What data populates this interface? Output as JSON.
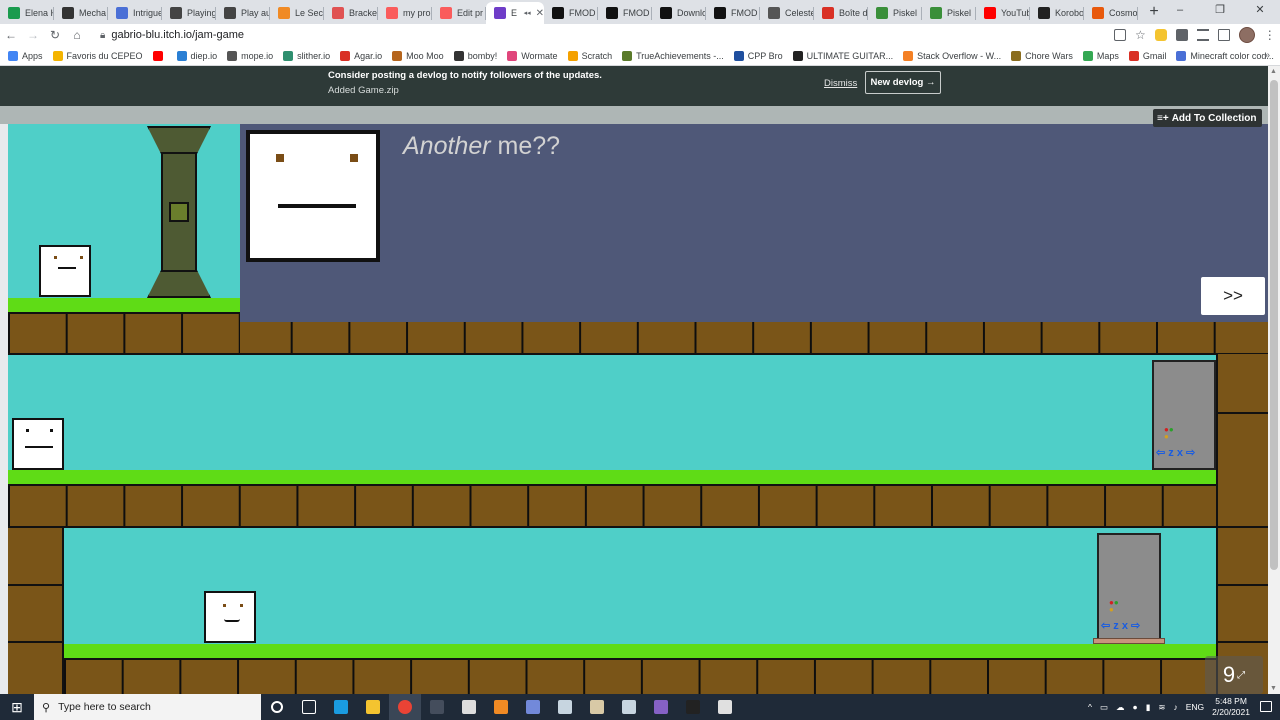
{
  "browser": {
    "tabs": [
      {
        "title": "Elena H",
        "color": "#1a9b4e"
      },
      {
        "title": "Mecha",
        "color": "#333333"
      },
      {
        "title": "Intrigue",
        "color": "#4a6fd6"
      },
      {
        "title": "Playing",
        "color": "#444444"
      },
      {
        "title": "Play au",
        "color": "#444444"
      },
      {
        "title": "Le Secr",
        "color": "#f08a24"
      },
      {
        "title": "Bracke",
        "color": "#e05252"
      },
      {
        "title": "my pro",
        "color": "#fa5c5c"
      },
      {
        "title": "Edit pr",
        "color": "#fa5c5c"
      },
      {
        "title": "E",
        "color": "#6f3dc8",
        "active": true
      },
      {
        "title": "FMOD",
        "color": "#111111"
      },
      {
        "title": "FMOD",
        "color": "#111111"
      },
      {
        "title": "Downlo",
        "color": "#111111"
      },
      {
        "title": "FMOD",
        "color": "#111111"
      },
      {
        "title": "Celeste",
        "color": "#555555"
      },
      {
        "title": "Boîte d",
        "color": "#d93025"
      },
      {
        "title": "Piskel",
        "color": "#3a8f3a"
      },
      {
        "title": "Piskel",
        "color": "#3a8f3a"
      },
      {
        "title": "YouTub",
        "color": "#ff0000"
      },
      {
        "title": "Korobo",
        "color": "#222222"
      },
      {
        "title": "Cosmo",
        "color": "#e8590c"
      }
    ],
    "new_tab": "+",
    "window_controls": [
      "–",
      "❐",
      "✕"
    ],
    "url": "gabrio-blu.itch.io/jam-game",
    "bookmarks": [
      {
        "label": "Apps",
        "color": "#4285f4"
      },
      {
        "label": "Favoris du CEPEO",
        "color": "#f4b400"
      },
      {
        "label": "",
        "color": "#ff0000"
      },
      {
        "label": "diep.io",
        "color": "#2a7fd4"
      },
      {
        "label": "mope.io",
        "color": "#555555"
      },
      {
        "label": "slither.io",
        "color": "#2f8f6f"
      },
      {
        "label": "Agar.io",
        "color": "#d93025"
      },
      {
        "label": "Moo Moo",
        "color": "#b5651d"
      },
      {
        "label": "bomby!",
        "color": "#333333"
      },
      {
        "label": "Wormate",
        "color": "#e0457b"
      },
      {
        "label": "Scratch",
        "color": "#f4a100"
      },
      {
        "label": "TrueAchievements -...",
        "color": "#5a7a2a"
      },
      {
        "label": "CPP Bro",
        "color": "#1f4f9f"
      },
      {
        "label": "ULTIMATE GUITAR...",
        "color": "#222222"
      },
      {
        "label": "Stack Overflow - W...",
        "color": "#f48024"
      },
      {
        "label": "Chore Wars",
        "color": "#8a6d1f"
      },
      {
        "label": "Maps",
        "color": "#34a853"
      },
      {
        "label": "Gmail",
        "color": "#d93025"
      },
      {
        "label": "Minecraft color cod...",
        "color": "#4a6fd6"
      }
    ],
    "bookmarks_more": "»"
  },
  "itch": {
    "banner_line1": "Consider posting a devlog to notify followers of the updates.",
    "banner_line2": "Added Game.zip",
    "dismiss": "Dismiss",
    "new_devlog": "New devlog →",
    "add_to_collection": "Add To Collection",
    "collection_icon": "≡+"
  },
  "game": {
    "dialog_title_italic": "Another",
    "dialog_title_rest": " me??",
    "next_button": ">>",
    "door_dots": "●●\n●",
    "door_arrows": "⇦ z x ⇨",
    "fullscreen_label": "9",
    "colors": {
      "sky": "#4fcfc8",
      "grass": "#5fdc16",
      "dirt": "#7a5518",
      "dialog_bg": "#4f5878",
      "pillar": "#4e5a33"
    }
  },
  "taskbar": {
    "search_placeholder": "Type here to search",
    "tray_lang": "ENG",
    "time": "5:48 PM",
    "date": "2/20/2021",
    "apps": [
      {
        "name": "task-view",
        "color": "#ffffff"
      },
      {
        "name": "edge",
        "color": "#1a9be0"
      },
      {
        "name": "file-explorer",
        "color": "#f4c430"
      },
      {
        "name": "chrome",
        "color": "#ea4335"
      },
      {
        "name": "calculator",
        "color": "#444d5c"
      },
      {
        "name": "unity",
        "color": "#dddddd"
      },
      {
        "name": "blender",
        "color": "#f08a24"
      },
      {
        "name": "discord",
        "color": "#7289da"
      },
      {
        "name": "steam-1",
        "color": "#c7d5e0"
      },
      {
        "name": "notes",
        "color": "#d8c9a6"
      },
      {
        "name": "steam-2",
        "color": "#c7d5e0"
      },
      {
        "name": "visual-studio",
        "color": "#8661c5"
      },
      {
        "name": "unity-hub",
        "color": "#222222"
      },
      {
        "name": "inkscape",
        "color": "#e0e0e0"
      }
    ]
  }
}
